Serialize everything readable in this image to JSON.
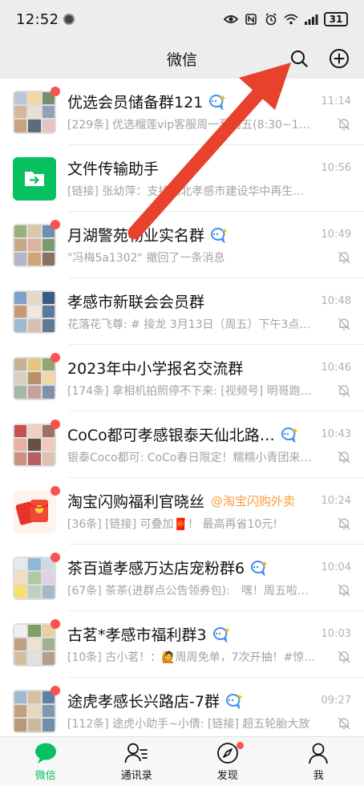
{
  "status_bar": {
    "time": "12:52",
    "battery": "31",
    "wifi_label": "6"
  },
  "header": {
    "title": "微信"
  },
  "chats": [
    {
      "name": "优选会员储备群121",
      "ai_badge": true,
      "time": "11:14",
      "preview": "[229条] 优选榴莲vip客服周一至周五(8:30~17:3…",
      "unread_dot": true,
      "muted": true,
      "avatar": "grid",
      "colors": [
        "#b9c7d6",
        "#f2d9a0",
        "#7a8c6e",
        "#d4b5a0",
        "#e8e0d0",
        "#8fa3b8",
        "#c9a27e",
        "#5d6b7a",
        "#e6c3c3"
      ]
    },
    {
      "name": "文件传输助手",
      "ai_badge": false,
      "time": "10:56",
      "preview": "[链接] 张幼萍：支持湖北孝感市建设华中再生…",
      "unread_dot": false,
      "muted": false,
      "avatar": "file"
    },
    {
      "name": "月湖警苑物业实名群",
      "ai_badge": true,
      "time": "10:49",
      "preview": "\"冯梅5a1302\" 撤回了一条消息",
      "unread_dot": true,
      "muted": true,
      "avatar": "grid",
      "colors": [
        "#9bb07a",
        "#d9c7a8",
        "#6f8fb0",
        "#c8a88a",
        "#e0b0a0",
        "#7d9a6a",
        "#b5b5c8",
        "#d2a574",
        "#8a7060"
      ]
    },
    {
      "name": "孝感市新联会会员群",
      "ai_badge": false,
      "time": "10:48",
      "preview": "花落花飞尊: # 接龙 3月13日（周五）下午3点…",
      "unread_dot": false,
      "muted": true,
      "avatar": "grid",
      "colors": [
        "#7fa0c8",
        "#e8d8c8",
        "#3a5a8a",
        "#c89878",
        "#f0e8e0",
        "#5a7a9a",
        "#a0b8d0",
        "#d8c0b0",
        "#607890"
      ]
    },
    {
      "name": "2023年中小学报名交流群",
      "ai_badge": false,
      "time": "10:46",
      "preview": "[174条] 拿相机拍照停不下来: [视频号] 明哥跑…",
      "unread_dot": true,
      "muted": true,
      "avatar": "grid",
      "colors": [
        "#c8b090",
        "#e8c878",
        "#90a870",
        "#d8d0c0",
        "#b8906a",
        "#f0d8a8",
        "#a8b8a0",
        "#c8a0a0",
        "#8090a8"
      ]
    },
    {
      "name": "CoCo都可孝感银泰天仙北路…",
      "ai_badge": true,
      "time": "10:43",
      "preview": "银泰Coco都可: CoCo春日限定！糯糯小青团来…",
      "unread_dot": true,
      "muted": true,
      "avatar": "grid",
      "colors": [
        "#c85050",
        "#f0d0c0",
        "#a07060",
        "#e8b0a0",
        "#6a5040",
        "#f0c8c0",
        "#d09080",
        "#b86060",
        "#e0c0b0"
      ]
    },
    {
      "name": "淘宝闪购福利官晓丝",
      "name_tag": "@淘宝闪购外卖",
      "ai_badge": false,
      "time": "10:24",
      "preview": "[36条] [链接] 可叠加🧧！ 最高再省10元!",
      "unread_dot": true,
      "muted": true,
      "avatar": "redpacket"
    },
    {
      "name": "茶百道孝感万达店宠粉群6",
      "ai_badge": true,
      "time": "10:04",
      "preview": "[67条] 茶茶(进群点公告领券包):　嘿！周五啦…",
      "unread_dot": true,
      "muted": true,
      "avatar": "grid",
      "colors": [
        "#e8e8f0",
        "#90b8d8",
        "#d0d8e0",
        "#f0e0c0",
        "#b0c8a0",
        "#e0d0e8",
        "#f8e070",
        "#c0d0c0",
        "#a8b8c8"
      ]
    },
    {
      "name": "古茗*孝感市福利群3",
      "ai_badge": true,
      "time": "10:03",
      "preview": "[10条] 古小茗！：🙋周周免单，7次开抽！#惊…",
      "unread_dot": true,
      "muted": true,
      "avatar": "grid",
      "colors": [
        "#f0f0f0",
        "#80a060",
        "#e8d0a0",
        "#c0a080",
        "#f0e0d0",
        "#a0b090",
        "#d0c0a0",
        "#e0e0e0",
        "#b0a090"
      ]
    },
    {
      "name": "途虎孝感长兴路店-7群",
      "ai_badge": true,
      "time": "09:27",
      "preview": "[112条] 途虎小助手~小倩: [链接] 超五轮胎大放",
      "unread_dot": true,
      "muted": true,
      "avatar": "grid",
      "colors": [
        "#a0b8d0",
        "#d8c0a0",
        "#6080a0",
        "#c0a080",
        "#e8d8c0",
        "#8098b0",
        "#b89878",
        "#d0b8a0",
        "#7090a8"
      ]
    }
  ],
  "tabs": [
    {
      "label": "微信",
      "active": true,
      "icon": "chat-bubble-icon",
      "dot": false
    },
    {
      "label": "通讯录",
      "active": false,
      "icon": "contacts-icon",
      "dot": false
    },
    {
      "label": "发现",
      "active": false,
      "icon": "compass-icon",
      "dot": true
    },
    {
      "label": "我",
      "active": false,
      "icon": "person-icon",
      "dot": false
    }
  ],
  "colors": {
    "accent_green": "#07c160",
    "unread_red": "#fa5151",
    "annotation_arrow": "#e8412c"
  }
}
